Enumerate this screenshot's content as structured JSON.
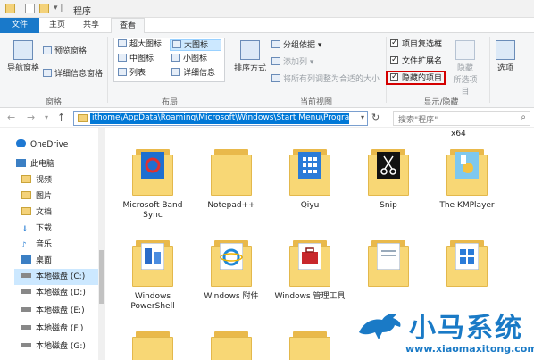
{
  "window": {
    "title": "程序"
  },
  "tabs": {
    "file": "文件",
    "home": "主页",
    "share": "共享",
    "view": "查看"
  },
  "ribbon": {
    "pane_group": {
      "nav_pane": "导航窗格",
      "preview_pane": "预览窗格",
      "details_pane": "详细信息窗格",
      "label": "窗格"
    },
    "layout_group": {
      "xl_icons": "超大图标",
      "large_icons": "大图标",
      "medium_icons": "中图标",
      "small_icons": "小图标",
      "list": "列表",
      "details": "详细信息",
      "label": "布局"
    },
    "view_group": {
      "sort_by": "排序方式",
      "group_by": "分组依据",
      "add_column": "添加列",
      "size_columns": "将所有列调整为合适的大小",
      "label": "当前视图"
    },
    "show_hide_group": {
      "item_checkboxes": "项目复选框",
      "file_extensions": "文件扩展名",
      "hidden_items": "隐藏的项目",
      "hide": "隐藏",
      "hide_selected": "所选项目",
      "label": "显示/隐藏"
    },
    "options": "选项"
  },
  "address": {
    "path": "ithome\\AppData\\Roaming\\Microsoft\\Windows\\Start Menu\\Programs",
    "search_placeholder": "搜索\"程序\""
  },
  "nav_pane": {
    "items": [
      {
        "label": "OneDrive",
        "icon": "cloud-icon"
      },
      {
        "label": "此电脑",
        "icon": "computer-icon"
      },
      {
        "label": "视频",
        "icon": "folder-icon"
      },
      {
        "label": "图片",
        "icon": "folder-icon"
      },
      {
        "label": "文档",
        "icon": "folder-icon"
      },
      {
        "label": "下载",
        "icon": "download-icon"
      },
      {
        "label": "音乐",
        "icon": "music-icon"
      },
      {
        "label": "桌面",
        "icon": "desktop-icon"
      },
      {
        "label": "本地磁盘 (C:)",
        "icon": "drive-icon"
      },
      {
        "label": "本地磁盘 (D:)",
        "icon": "drive-icon"
      },
      {
        "label": "本地磁盘 (E:)",
        "icon": "drive-icon"
      },
      {
        "label": "本地磁盘 (F:)",
        "icon": "drive-icon"
      },
      {
        "label": "本地磁盘 (G:)",
        "icon": "drive-icon"
      }
    ]
  },
  "content": {
    "x64_label": "x64",
    "folders": [
      {
        "label": "Microsoft Band Sync"
      },
      {
        "label": "Notepad++"
      },
      {
        "label": "Qiyu"
      },
      {
        "label": "Snip"
      },
      {
        "label": "The KMPlayer"
      },
      {
        "label": "Windows PowerShell"
      },
      {
        "label": "Windows 附件"
      },
      {
        "label": "Windows 管理工具"
      },
      {
        "label": ""
      },
      {
        "label": ""
      }
    ]
  },
  "watermark": {
    "name": "小马系统",
    "url": "www.xiaomaxitong.com"
  },
  "colors": {
    "accent": "#1979ca",
    "selection": "#cce8ff",
    "highlight_border": "#d40000",
    "folder": "#f8d775"
  }
}
